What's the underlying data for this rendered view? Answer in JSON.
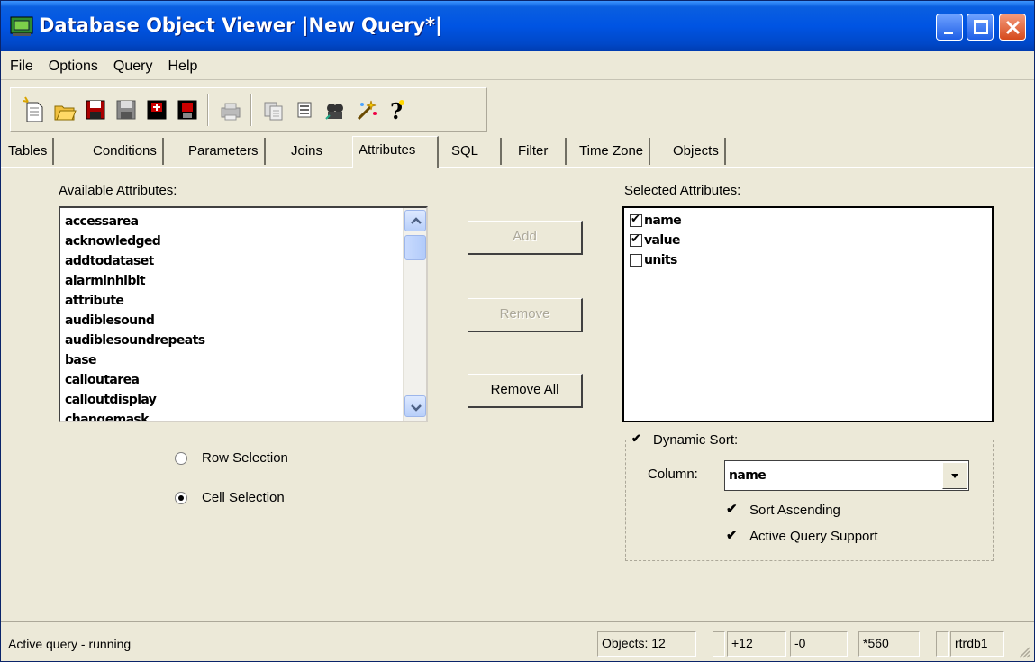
{
  "window": {
    "title": "Database Object Viewer |New Query*|",
    "colors": {
      "titlebar": "#0054e3",
      "close": "#d54a1c",
      "face": "#ece9d8"
    }
  },
  "menu": [
    "File",
    "Options",
    "Query",
    "Help"
  ],
  "toolbar": {
    "icons": [
      "new-query-icon",
      "open-icon",
      "save-icon",
      "save-disabled-icon",
      "save-as-icon",
      "save-all-icon",
      "print-icon",
      "copy-icon",
      "list-icon",
      "find-icon",
      "wizard-icon",
      "help-icon"
    ]
  },
  "tabs": [
    "Tables",
    "Conditions",
    "Parameters",
    "Joins",
    "Attributes",
    "SQL",
    "Filter",
    "Time Zone",
    "Objects"
  ],
  "active_tab": "Attributes",
  "available": {
    "label": "Available Attributes:",
    "items": [
      "accessarea",
      "acknowledged",
      "addtodataset",
      "alarminhibit",
      "attribute",
      "audiblesound",
      "audiblesoundrepeats",
      "base",
      "calloutarea",
      "calloutdisplay",
      "changemask"
    ]
  },
  "buttons": {
    "add": "Add",
    "remove": "Remove",
    "remove_all": "Remove All"
  },
  "selection_mode": {
    "row": "Row Selection",
    "cell": "Cell Selection",
    "selected": "cell"
  },
  "selected": {
    "label": "Selected Attributes:",
    "items": [
      {
        "name": "name",
        "checked": true
      },
      {
        "name": "value",
        "checked": true
      },
      {
        "name": "units",
        "checked": false
      }
    ]
  },
  "dynamic_sort": {
    "label": "Dynamic Sort:",
    "enabled": true,
    "column_label": "Column:",
    "column_value": "name",
    "sort_ascending": "Sort Ascending",
    "active_query_support": "Active Query Support"
  },
  "status": {
    "message": "Active query - running",
    "objects": "Objects: 12",
    "plus": "+12",
    "minus": "-0",
    "count": "*560",
    "db": "rtrdb1"
  }
}
